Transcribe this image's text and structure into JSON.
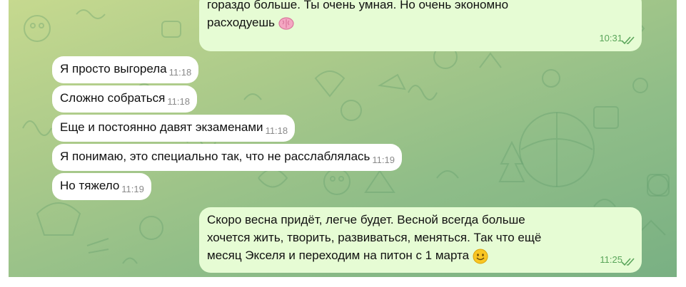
{
  "chat": {
    "outgoing_top": {
      "line1": "гораздо больше. Ты очень умная. Но очень экономно",
      "line2": "расходуешь",
      "emoji": "brain-emoji",
      "time": "10:31"
    },
    "incoming": [
      {
        "text": "Я просто выгорела",
        "time": "11:18"
      },
      {
        "text": "Сложно собраться",
        "time": "11:18"
      },
      {
        "text": "Еще и постоянно давят экзаменами",
        "time": "11:18"
      },
      {
        "text": "Я понимаю, это специально так, что не расслаблялась",
        "time": "11:19"
      },
      {
        "text": "Но тяжело",
        "time": "11:19"
      }
    ],
    "outgoing_bottom": {
      "line1": "Скоро весна придёт, легче будет. Весной всегда больше",
      "line2": "хочется жить, творить, развиваться, меняться. Так что ещё",
      "line3": "месяц Экселя и переходим на питон с 1 марта",
      "emoji": "smiling-face-emoji",
      "time": "11:25"
    }
  },
  "colors": {
    "incoming_bubble": "#ffffff",
    "outgoing_bubble": "#e6fcd4",
    "outgoing_time": "#5aa55a",
    "incoming_time": "#8a8a8a"
  },
  "icons": [
    "double-check-icon",
    "brain-emoji",
    "smiling-face-emoji"
  ]
}
